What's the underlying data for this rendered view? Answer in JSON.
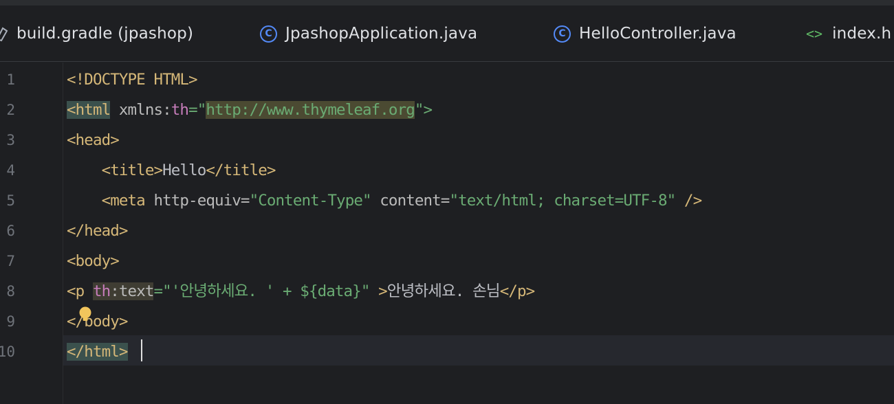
{
  "tabs": [
    {
      "label": "build.gradle (jpashop)",
      "icon": "gradle-icon"
    },
    {
      "label": "JpashopApplication.java",
      "icon": "java-class-icon"
    },
    {
      "label": "HelloController.java",
      "icon": "java-class-icon"
    },
    {
      "label": "index.h",
      "icon": "html-file-icon"
    }
  ],
  "icons": {
    "java_class_glyph": "C",
    "html_glyph": "<>"
  },
  "line_numbers": [
    "1",
    "2",
    "3",
    "4",
    "5",
    "6",
    "7",
    "8",
    "9",
    "10"
  ],
  "code": {
    "l1": {
      "t": "<!DOCTYPE HTML>"
    },
    "l2": {
      "open": "<html",
      "attr": " xmlns:",
      "ns": "th",
      "eq": "=\"",
      "val": "http://www.thymeleaf.org",
      "close": "\">"
    },
    "l3": {
      "t": "<head>"
    },
    "l4": {
      "indent": "    ",
      "open": "<title>",
      "text": "Hello",
      "close": "</title>"
    },
    "l5": {
      "indent": "    ",
      "open": "<meta",
      "attr1": " http-equiv=",
      "val1": "\"Content-Type\"",
      "attr2": " content=",
      "val2": "\"text/html; charset=UTF-8\"",
      "close": " />"
    },
    "l6": {
      "t": "</head>"
    },
    "l7": {
      "t": "<body>"
    },
    "l8": {
      "open": "<p ",
      "ns": "th",
      "attr": ":text",
      "eq": "=",
      "val": "\"'안녕하세요. ' + ${data}\"",
      "close": " >",
      "text": "안녕하세요. 손님",
      "end": "</p>"
    },
    "l9": {
      "t": "</body>"
    },
    "l10": {
      "t": "</html>"
    }
  },
  "colors": {
    "background": "#1e1f22",
    "tag": "#d5b778",
    "attribute": "#bababa",
    "namespace": "#c77dbb",
    "string": "#6aab73",
    "line_number": "#6f737a",
    "java_icon": "#548af7",
    "html_icon": "#5fb865"
  }
}
